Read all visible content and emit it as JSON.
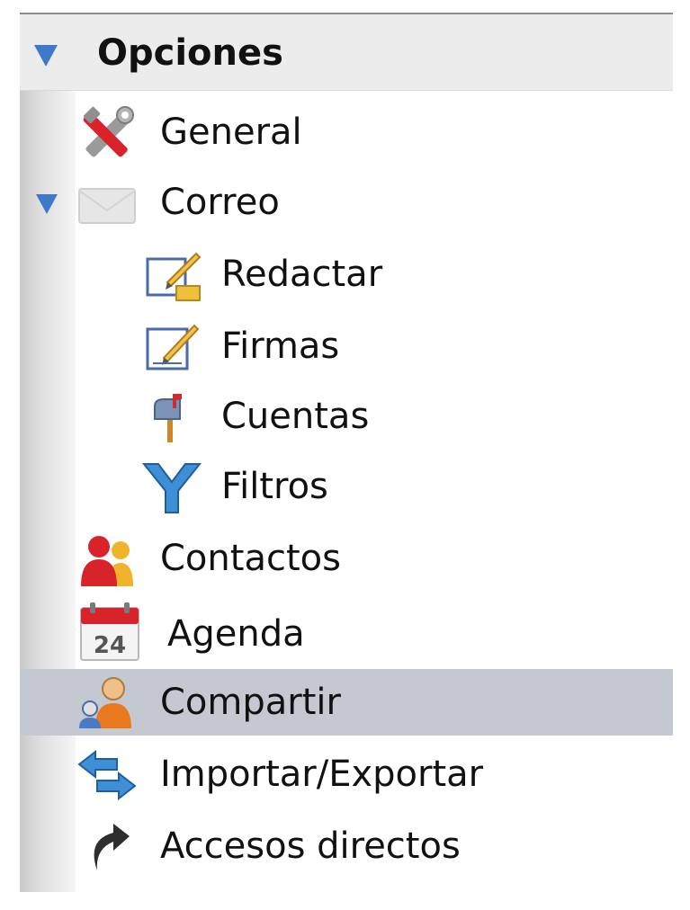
{
  "header": {
    "title": "Opciones"
  },
  "items": [
    {
      "label": "General"
    },
    {
      "label": "Correo"
    },
    {
      "label": "Redactar"
    },
    {
      "label": "Firmas"
    },
    {
      "label": "Cuentas"
    },
    {
      "label": "Filtros"
    },
    {
      "label": "Contactos"
    },
    {
      "label": "Agenda",
      "calendar_day": "24"
    },
    {
      "label": "Compartir"
    },
    {
      "label": "Importar/Exportar"
    },
    {
      "label": "Accesos directos"
    }
  ],
  "colors": {
    "arrow": "#3f79c9",
    "selected_row": "#c4c8d0",
    "header_bg": "#ececec"
  }
}
